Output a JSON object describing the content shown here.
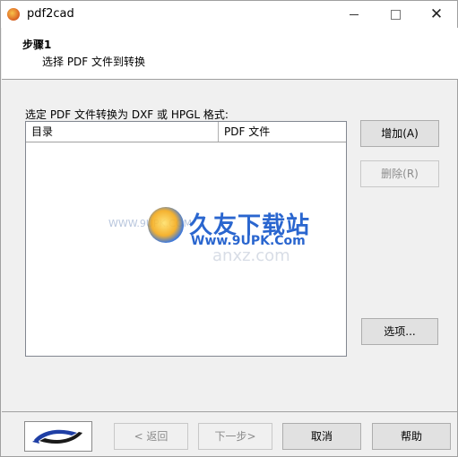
{
  "window": {
    "title": "pdf2cad",
    "controls": {
      "minimize": "—",
      "maximize": "□",
      "close": "✕"
    }
  },
  "header": {
    "step_title": "步骤1",
    "step_description": "选择 PDF 文件到转换"
  },
  "file_list": {
    "label": "选定 PDF 文件转换为 DXF 或 HPGL 格式:",
    "columns": [
      "目录",
      "PDF 文件"
    ],
    "rows": []
  },
  "side_buttons": {
    "add": "增加(A)",
    "delete": "删除(R)",
    "options": "选项..."
  },
  "watermark": {
    "main": "久友下载站",
    "url": "Www.9UPK.Com",
    "faint_left": "WWW.9UPK.COM",
    "faint_right": "anxz.com"
  },
  "footer": {
    "back": "< 返回",
    "next": "下一步>",
    "cancel": "取消",
    "help": "帮助"
  },
  "colors": {
    "accent_blue": "#2a66cf",
    "disabled_text": "#8c8c8c",
    "button_face": "#e1e1e1",
    "dialog_bg": "#f0f0f0"
  },
  "icons": {
    "app": "pdf2cad-app-icon",
    "logo": "pdf2cad-swoosh-logo"
  }
}
